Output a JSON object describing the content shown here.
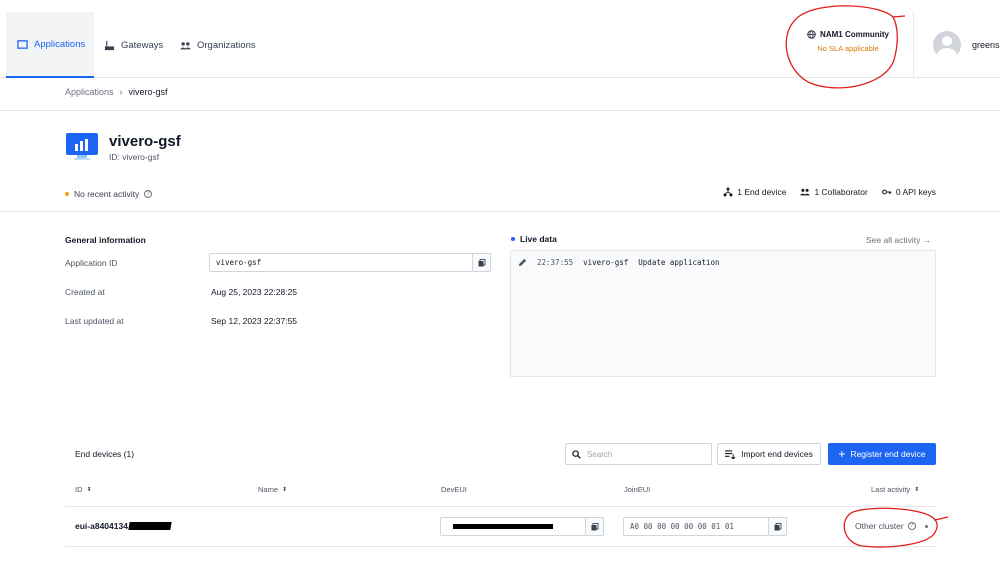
{
  "nav": {
    "items": [
      {
        "label": "Applications",
        "icon": "application-icon"
      },
      {
        "label": "Gateways",
        "icon": "gateway-icon"
      },
      {
        "label": "Organizations",
        "icon": "organization-icon"
      }
    ],
    "cluster": {
      "name": "NAM1 Community",
      "sla": "No SLA applicable"
    },
    "user": {
      "name": "greens"
    }
  },
  "breadcrumb": [
    "Applications",
    "vivero-gsf"
  ],
  "app": {
    "title": "vivero-gsf",
    "id_line": "ID: vivero-gsf",
    "activity": "No recent activity",
    "stats": {
      "end_devices": "1 End device",
      "collaborators": "1 Collaborator",
      "api_keys": "0 API keys"
    }
  },
  "general_info": {
    "title": "General information",
    "application_id_label": "Application ID",
    "application_id": "vivero-gsf",
    "created_label": "Created at",
    "created": "Aug 25, 2023 22:28:25",
    "updated_label": "Last updated at",
    "updated": "Sep 12, 2023 22:37:55"
  },
  "live_data": {
    "title": "Live data",
    "see_all": "See all activity →",
    "events": [
      {
        "time": "22:37:55",
        "app": "vivero-gsf",
        "message": "Update application"
      }
    ]
  },
  "end_devices": {
    "title": "End devices (1)",
    "search_placeholder": "Search",
    "import_label": "Import end devices",
    "register_label": "Register end device",
    "columns": [
      "ID",
      "Name",
      "DevEUI",
      "JoinEUI",
      "Last activity"
    ],
    "rows": [
      {
        "id": "eui-a8404134",
        "name": "",
        "dev_eui": "",
        "join_eui": "A0 00 00 00 00 00 01 01",
        "last_activity": "Other cluster"
      }
    ]
  },
  "colors": {
    "primary": "#1c64f2",
    "warning": "#d97706",
    "annotation": "#e11d1d"
  }
}
